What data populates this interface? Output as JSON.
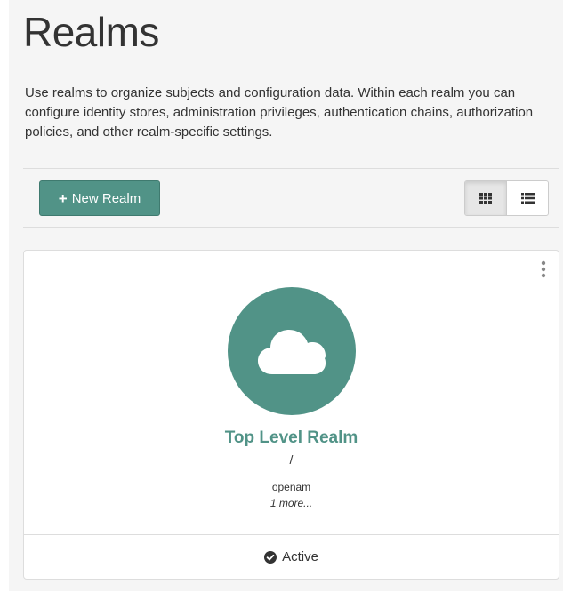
{
  "page": {
    "title": "Realms",
    "description": "Use realms to organize subjects and configuration data. Within each realm you can configure identity stores, administration privileges, authentication chains, authorization policies, and other realm-specific settings."
  },
  "toolbar": {
    "new_realm_label": "New Realm",
    "view_modes": [
      "grid",
      "list"
    ],
    "active_view": "grid"
  },
  "realm_card": {
    "name": "Top Level Realm",
    "path": "/",
    "alias": "openam",
    "more_aliases": "1 more...",
    "status": "Active",
    "icon": "cloud-icon"
  },
  "colors": {
    "accent": "#519387",
    "background": "#f5f5f5",
    "border": "#dddddd"
  }
}
